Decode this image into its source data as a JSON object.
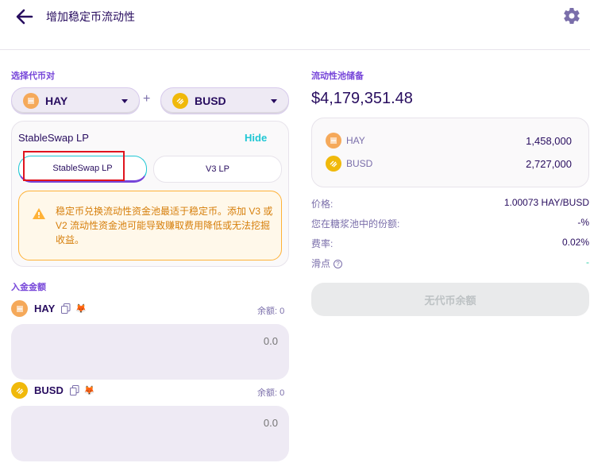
{
  "header": {
    "title": "增加稳定币流动性"
  },
  "select_section": {
    "label": "选择代币对",
    "token_a": {
      "symbol": "HAY"
    },
    "plus": "+",
    "token_b": {
      "symbol": "BUSD"
    }
  },
  "lp_card": {
    "type_label": "StableSwap LP",
    "hide_label": "Hide",
    "tabs": [
      "StableSwap LP",
      "V3 LP"
    ],
    "active_tab": "StableSwap LP",
    "warning_text": "稳定币兑换流动性资金池最适于稳定币。添加 V3 或 V2 流动性资金池可能导致赚取费用降低或无法挖掘收益。"
  },
  "deposit": {
    "label": "入金金额",
    "tokens": [
      {
        "symbol": "HAY",
        "balance_label": "余额: 0",
        "placeholder": "0.0"
      },
      {
        "symbol": "BUSD",
        "balance_label": "余额: 0",
        "placeholder": "0.0"
      }
    ]
  },
  "pool": {
    "label": "流动性池储备",
    "total": "$4,179,351.48",
    "reserves": [
      {
        "symbol": "HAY",
        "amount": "1,458,000"
      },
      {
        "symbol": "BUSD",
        "amount": "2,727,000"
      }
    ],
    "info": [
      {
        "label": "价格:",
        "value": "1.00073 HAY/BUSD"
      },
      {
        "label": "您在糖浆池中的份额:",
        "value": "-%"
      },
      {
        "label": "费率:",
        "value": "0.02%"
      },
      {
        "label": "滑点",
        "value": "-"
      }
    ],
    "button_label": "无代币余额"
  },
  "colors": {
    "primary_text": "#280d5f",
    "accent_purple": "#7645d9",
    "accent_cyan": "#1fc7d4",
    "warning": "#d67e0a",
    "success": "#31d0aa",
    "hay_coin": "#f5a95a",
    "busd_coin": "#f0b90b"
  }
}
